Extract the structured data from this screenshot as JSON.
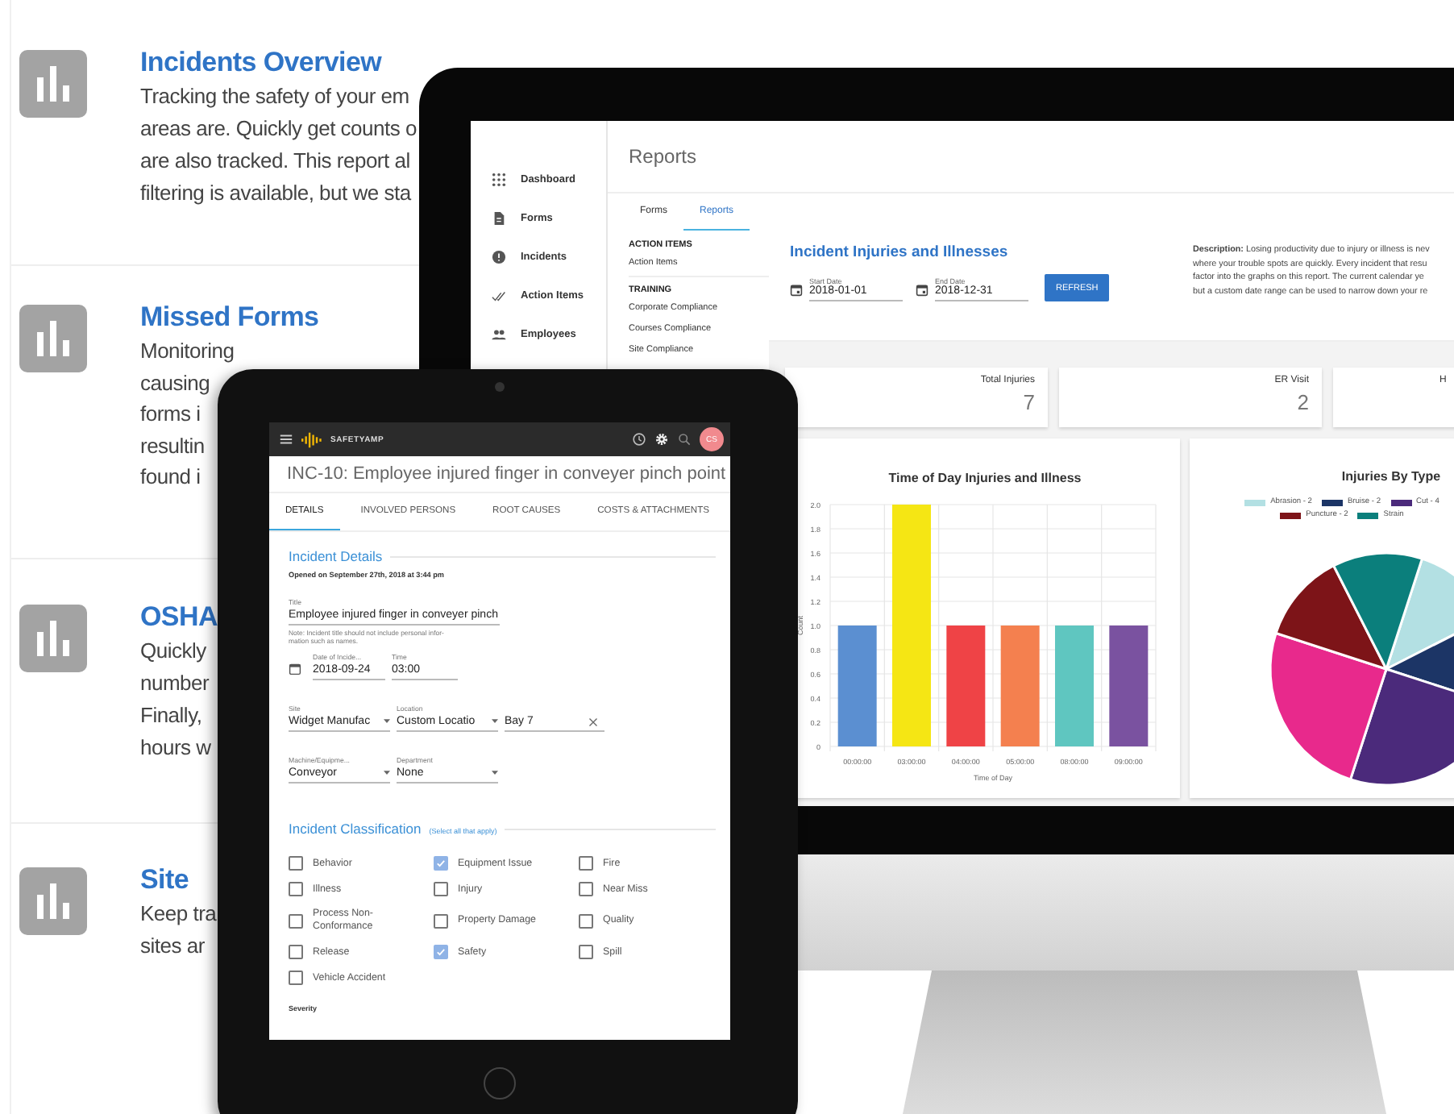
{
  "report_list": [
    {
      "title": "Incidents Overview",
      "lines": [
        "Tracking the safety of your em",
        "areas are. Quickly get counts o",
        "are also tracked. This report al",
        "filtering is available, but we sta"
      ]
    },
    {
      "title": "Missed Forms",
      "lines": [
        "Monitoring",
        "causing",
        "forms i",
        "resultin",
        "found i"
      ]
    },
    {
      "title": "OSHA",
      "lines": [
        "Quickly",
        "number",
        "Finally,",
        "hours w"
      ]
    },
    {
      "title": "Site",
      "lines": [
        "Keep tra",
        "sites ar"
      ]
    }
  ],
  "monitor": {
    "sidebar": [
      {
        "label": "Dashboard"
      },
      {
        "label": "Forms"
      },
      {
        "label": "Incidents"
      },
      {
        "label": "Action Items"
      },
      {
        "label": "Employees"
      }
    ],
    "page_title": "Reports",
    "tabs": [
      {
        "label": "Forms",
        "selected": false
      },
      {
        "label": "Reports",
        "selected": true
      }
    ],
    "report_menu": [
      {
        "kind": "heading",
        "label": "ACTION ITEMS"
      },
      {
        "kind": "item",
        "label": "Action Items"
      },
      {
        "kind": "heading",
        "label": "TRAINING"
      },
      {
        "kind": "item",
        "label": "Corporate Compliance"
      },
      {
        "kind": "item",
        "label": "Courses Compliance"
      },
      {
        "kind": "item",
        "label": "Site Compliance"
      }
    ],
    "report_title": "Incident Injuries and Illnesses",
    "date_fields": [
      {
        "label": "Start Date",
        "value": "2018-01-01"
      },
      {
        "label": "End Date",
        "value": "2018-12-31"
      }
    ],
    "refresh_button": "REFRESH",
    "description": [
      "**Description:** Losing productivity due to injury or illness is nev",
      "where your trouble spots are quickly. Every incident that resu",
      "factor into the graphs on this report. The current calendar ye",
      "but a custom date range can be used to narrow down your re"
    ],
    "stats": [
      {
        "label": "Total Injuries",
        "value": "7"
      },
      {
        "label": "ER Visit",
        "value": "2"
      },
      {
        "label": "H"
      }
    ],
    "bar_chart": {
      "chart_data": {
        "type": "bar",
        "title": "Time of Day Injuries and Illness",
        "xlabel": "Time of Day",
        "ylabel": "Count",
        "categories": [
          "00:00:00",
          "03:00:00",
          "04:00:00",
          "05:00:00",
          "08:00:00",
          "09:00:00"
        ],
        "series": [
          {
            "color": "#5b8fd1",
            "values": [
              1,
              null,
              null,
              null,
              null,
              null
            ]
          },
          {
            "color": "#f5e614",
            "values": [
              null,
              2,
              null,
              null,
              null,
              null
            ]
          },
          {
            "color": "#ef4346",
            "values": [
              null,
              null,
              1,
              null,
              null,
              null
            ]
          },
          {
            "color": "#f4804f",
            "values": [
              null,
              null,
              null,
              1,
              null,
              null
            ]
          },
          {
            "color": "#5fc6c0",
            "values": [
              null,
              null,
              null,
              null,
              1,
              null
            ]
          },
          {
            "color": "#7a52a0",
            "values": [
              null,
              null,
              null,
              null,
              null,
              1
            ]
          }
        ],
        "stacked": true,
        "grid": true,
        "ylim": [
          0,
          2
        ],
        "yticks": [
          0,
          0.2,
          0.4,
          0.6,
          0.8,
          {
            "value": 1,
            "label": "1.0"
          },
          1.2,
          1.4,
          1.6,
          1.8,
          {
            "value": 2,
            "label": "2.0"
          }
        ]
      }
    },
    "pie_chart": {
      "legend": [
        {
          "label": "Abrasion - 2",
          "color": "#b3e0e3"
        },
        {
          "label": "Bruise - 2",
          "color": "#1c3566"
        },
        {
          "label": "Cut - 4",
          "color": "#4b2a7b"
        },
        {
          "label": "Puncture - 2",
          "color": "#7d1418"
        },
        {
          "label": "Strain",
          "color": "#0b7f7c"
        }
      ],
      "chart_data": {
        "type": "pie",
        "title": "Injuries By Type",
        "series": [
          {
            "values": [
              12.5,
              12.5,
              25,
              25,
              12.5,
              12.5
            ]
          }
        ]
      }
    }
  },
  "tablet": {
    "app_name": "SAFETYAMP",
    "avatar": "CS",
    "title": "INC-10: Employee injured finger in conveyer pinch point",
    "tabs": [
      {
        "label": "DETAILS",
        "selected": true
      },
      {
        "label": "INVOLVED PERSONS",
        "selected": false
      },
      {
        "label": "ROOT CAUSES",
        "selected": false
      },
      {
        "label": "COSTS & ATTACHMENTS",
        "selected": false
      }
    ],
    "section_title": "Incident Details",
    "opened": "Opened on September 27th, 2018 at 3:44 pm",
    "title_field": {
      "label": "Title",
      "value": "Employee injured finger in conveyer pinch"
    },
    "note": [
      "Note: Incident title should not include personal infor-",
      "mation such as names."
    ],
    "field_rows": [
      [
        {
          "kind": "date",
          "label": "Date of Incide...",
          "value": "2018-09-24"
        },
        {
          "kind": "text",
          "label": "Time",
          "value": "03:00"
        }
      ],
      [
        {
          "kind": "select",
          "label": "Site",
          "value": "Widget Manufac"
        },
        {
          "kind": "select",
          "label": "Location",
          "value": "Custom Locatio"
        },
        {
          "kind": "clearable",
          "value": "Bay 7"
        }
      ],
      [
        {
          "kind": "select",
          "label": "Machine/Equipme...",
          "value": "Conveyor"
        },
        {
          "kind": "select",
          "label": "Department",
          "value": "None"
        }
      ]
    ],
    "classification": {
      "title": "Incident Classification",
      "hint": "(Select all that apply)",
      "options": [
        {
          "label": "Behavior",
          "checked": false
        },
        {
          "label": "Equipment Issue",
          "checked": true
        },
        {
          "label": "Fire",
          "checked": false
        },
        {
          "label": "Illness",
          "checked": false
        },
        {
          "label": "Injury",
          "checked": false
        },
        {
          "label": "Near Miss",
          "checked": false
        },
        {
          "label": "Process Non-Conformance",
          "checked": false
        },
        {
          "label": "Property Damage",
          "checked": false
        },
        {
          "label": "Quality",
          "checked": false
        },
        {
          "label": "Release",
          "checked": false
        },
        {
          "label": "Safety",
          "checked": true
        },
        {
          "label": "Spill",
          "checked": false
        },
        {
          "label": "Vehicle Accident",
          "checked": false
        }
      ]
    },
    "severity_label": "Severity"
  }
}
